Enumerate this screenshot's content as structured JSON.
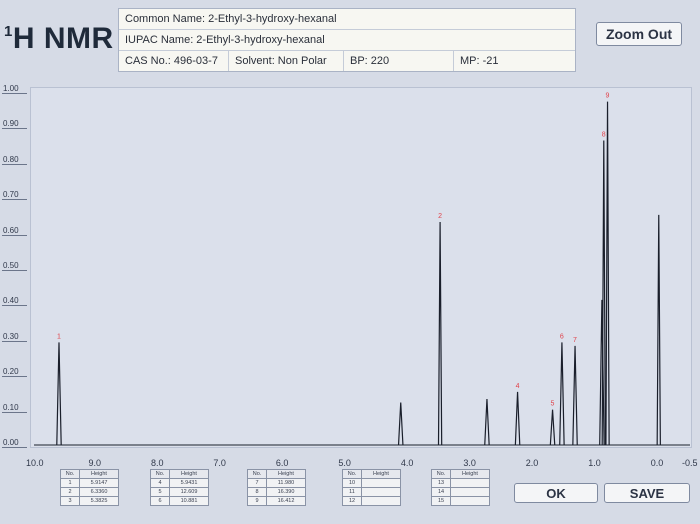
{
  "title": {
    "sup": "1",
    "main": "H NMR"
  },
  "info": {
    "common_name": "Common Name: 2-Ethyl-3-hydroxy-hexanal",
    "iupac_name": "IUPAC Name: 2-Ethyl-3-hydroxy-hexanal",
    "cas": "CAS No.: 496-03-7",
    "solvent": "Solvent: Non Polar",
    "bp": "BP: 220",
    "mp": "MP: -21"
  },
  "buttons": {
    "zoom_out": "Zoom Out",
    "ok": "OK",
    "save": "SAVE"
  },
  "y_ticks": [
    "1.00",
    "0.90",
    "0.80",
    "0.70",
    "0.60",
    "0.50",
    "0.40",
    "0.30",
    "0.20",
    "0.10",
    "0.00"
  ],
  "x_ticks": [
    "10.0",
    "9.0",
    "8.0",
    "7.0",
    "6.0",
    "5.0",
    "4.0",
    "3.0",
    "2.0",
    "1.0",
    "0.0",
    "-0.5"
  ],
  "tables": [
    {
      "header_no": "No.",
      "header_height": "Height",
      "rows": [
        [
          "1",
          "5.9147"
        ],
        [
          "2",
          "6.3360"
        ],
        [
          "3",
          "5.3825"
        ]
      ]
    },
    {
      "header_no": "No.",
      "header_height": "Height",
      "rows": [
        [
          "4",
          "5.9431"
        ],
        [
          "5",
          "12.609"
        ],
        [
          "6",
          "10.881"
        ]
      ]
    },
    {
      "header_no": "No.",
      "header_height": "Height",
      "rows": [
        [
          "7",
          "11.980"
        ],
        [
          "8",
          "16.390"
        ],
        [
          "9",
          "16.412"
        ]
      ]
    },
    {
      "header_no": "No.",
      "header_height": "Height",
      "rows": [
        [
          "10",
          ""
        ],
        [
          "11",
          ""
        ],
        [
          "12",
          ""
        ]
      ]
    },
    {
      "header_no": "No.",
      "header_height": "Height",
      "rows": [
        [
          "13",
          ""
        ],
        [
          "14",
          ""
        ],
        [
          "15",
          ""
        ]
      ]
    }
  ],
  "chart_data": {
    "type": "line",
    "xlabel": "",
    "ylabel": "",
    "xlim": [
      10.0,
      -0.5
    ],
    "ylim": [
      0.0,
      1.0
    ],
    "grid": false,
    "colors": {
      "spectrum": "#1a1f2b",
      "peak_label": "#e0424a"
    },
    "peaks": [
      {
        "label": "1",
        "ppm": 9.6,
        "height": 0.29
      },
      {
        "label": "",
        "ppm": 4.13,
        "height": 0.12
      },
      {
        "label": "2",
        "ppm": 3.5,
        "height": 0.63
      },
      {
        "label": "",
        "ppm": 2.75,
        "height": 0.13
      },
      {
        "label": "4",
        "ppm": 2.26,
        "height": 0.15
      },
      {
        "label": "5",
        "ppm": 1.7,
        "height": 0.1
      },
      {
        "label": "6",
        "ppm": 1.55,
        "height": 0.29
      },
      {
        "label": "7",
        "ppm": 1.34,
        "height": 0.28
      },
      {
        "label": "",
        "ppm": 0.91,
        "height": 0.41
      },
      {
        "label": "8",
        "ppm": 0.88,
        "height": 0.86
      },
      {
        "label": "9",
        "ppm": 0.82,
        "height": 0.97
      },
      {
        "label": "",
        "ppm": 0.0,
        "height": 0.65
      }
    ]
  }
}
